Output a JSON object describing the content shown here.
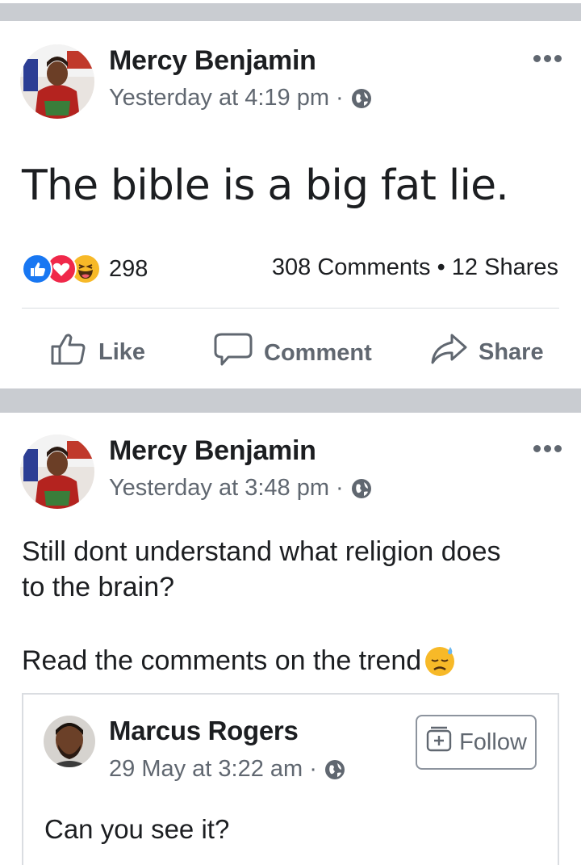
{
  "posts": [
    {
      "author": "Mercy Benjamin",
      "time": "Yesterday at 4:19 pm",
      "privacy_icon": "globe-icon",
      "text": "The bible is a big fat lie.",
      "reactions": {
        "icons": [
          "like-reaction-icon",
          "love-reaction-icon",
          "haha-reaction-icon"
        ],
        "count": "298"
      },
      "comments_shares": "308 Comments • 12 Shares",
      "actions": {
        "like": "Like",
        "comment": "Comment",
        "share": "Share"
      }
    },
    {
      "author": "Mercy Benjamin",
      "time": "Yesterday at 3:48 pm",
      "privacy_icon": "globe-icon",
      "text_line1": "Still dont understand what religion does",
      "text_line2": "to the brain?",
      "text_line3": "Read the comments on the trend",
      "emoji": "😓",
      "shared": {
        "author": "Marcus Rogers",
        "time": "29 May at 3:22 am",
        "follow_label": "Follow",
        "text": "Can you see it?"
      }
    }
  ],
  "colors": {
    "separator": "#c9ccd1",
    "secondary_text": "#606770",
    "like_blue": "#1877f2",
    "love_red": "#f0284a",
    "haha_yellow": "#f7b928"
  }
}
